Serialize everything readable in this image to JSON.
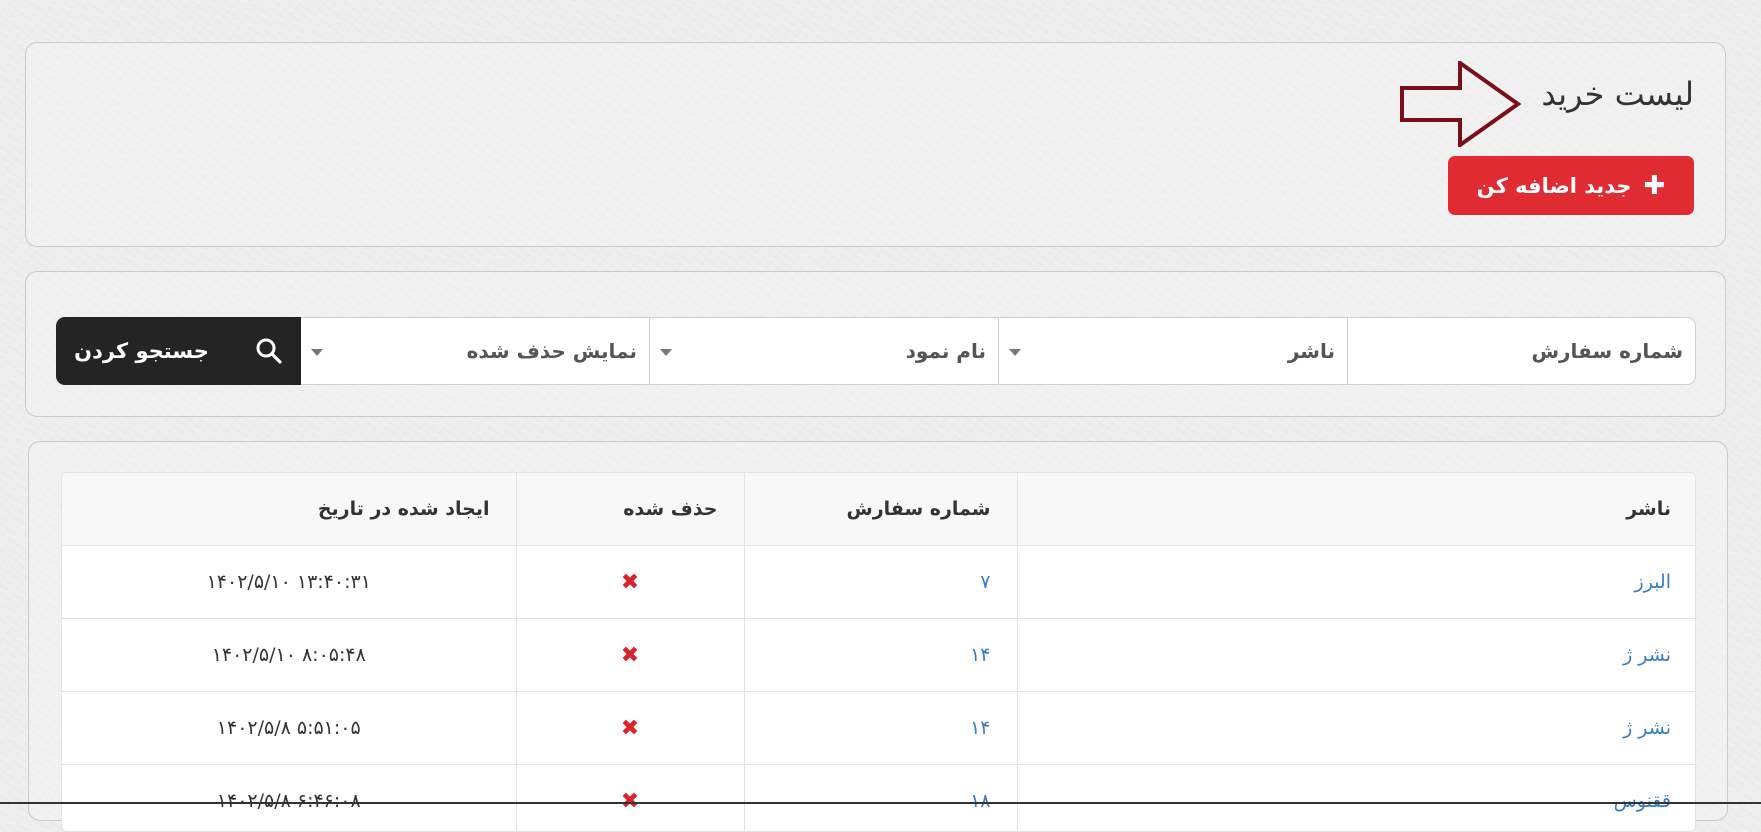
{
  "header": {
    "title": "لیست خرید",
    "add_button_label": "جدید اضافه کن",
    "add_button_icon": "plus-icon",
    "arrow_color": "#7a0f1a",
    "button_color": "#e02b33"
  },
  "filters": {
    "fields": [
      {
        "label": "شماره سفارش",
        "type": "input"
      },
      {
        "label": "ناشر",
        "type": "select"
      },
      {
        "label": "نام نمود",
        "type": "select"
      },
      {
        "label": "نمایش حذف شده",
        "type": "select"
      }
    ],
    "search_button_label": "جستجو کردن",
    "search_icon": "search-icon"
  },
  "table": {
    "columns": [
      "ناشر",
      "شماره سفارش",
      "حذف شده",
      "ایجاد شده در تاریخ"
    ],
    "rows": [
      {
        "publisher": "البرز",
        "order_number": "۷",
        "deleted": "✖",
        "created": "۱۴۰۲/۵/۱۰ ۱۳:۴۰:۳۱"
      },
      {
        "publisher": "نشر ژ",
        "order_number": "۱۴",
        "deleted": "✖",
        "created": "۱۴۰۲/۵/۱۰ ۸:۰۵:۴۸"
      },
      {
        "publisher": "نشر ژ",
        "order_number": "۱۴",
        "deleted": "✖",
        "created": "۱۴۰۲/۵/۸ ۵:۵۱:۰۵"
      },
      {
        "publisher": "ققنوس",
        "order_number": "۱۸",
        "deleted": "✖",
        "created": "۱۴۰۲/۵/۸ ۶:۴۶:۰۸"
      }
    ]
  }
}
